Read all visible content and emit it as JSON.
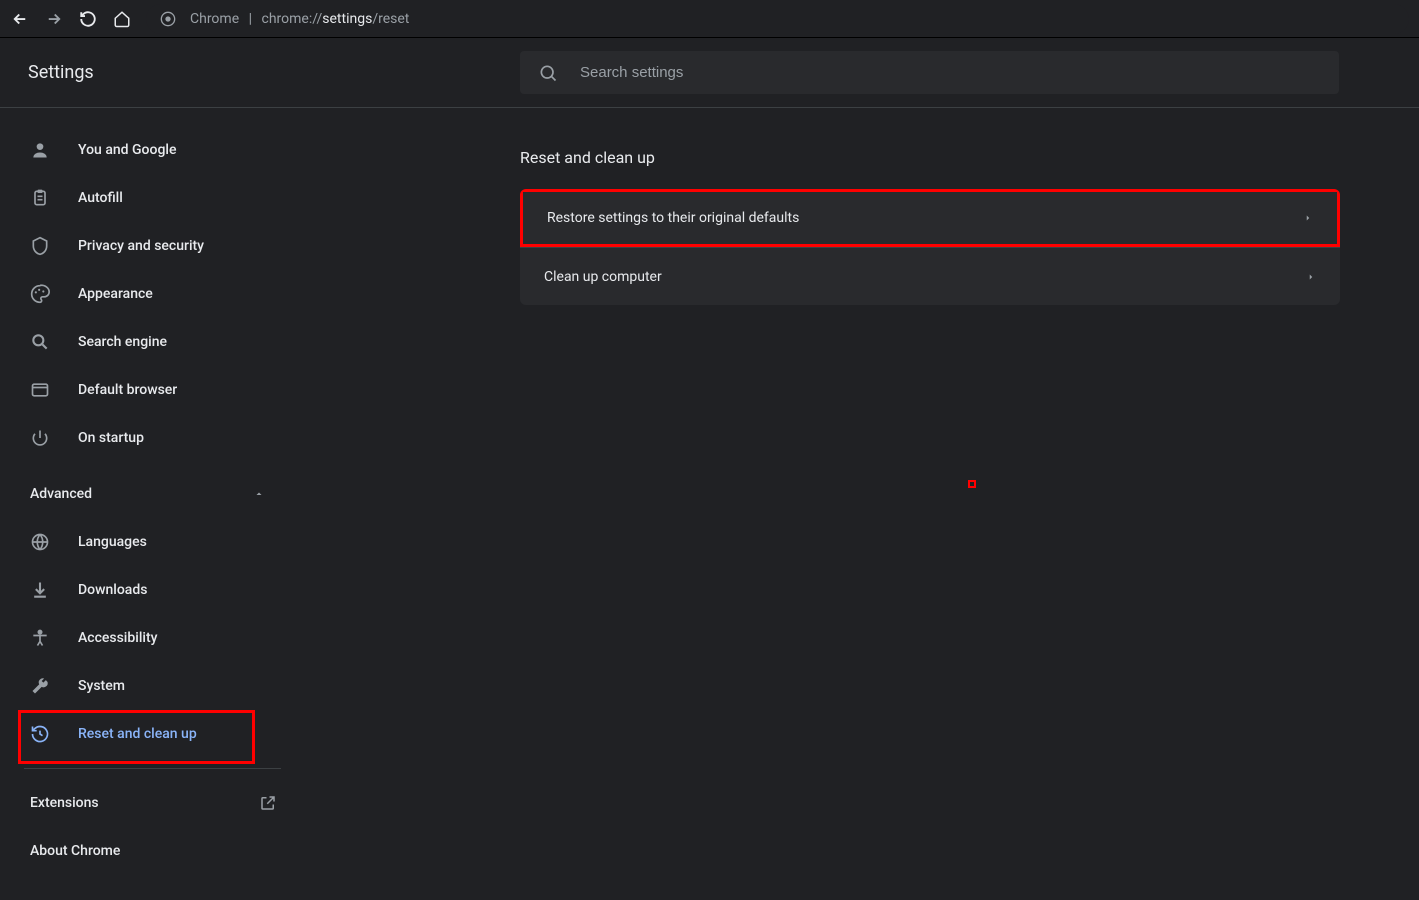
{
  "browser": {
    "url_prefix": "Chrome",
    "url_dim": "chrome://",
    "url_strong": "settings",
    "url_suffix": "/reset"
  },
  "header": {
    "title": "Settings",
    "search_placeholder": "Search settings"
  },
  "sidebar": {
    "items": [
      {
        "label": "You and Google"
      },
      {
        "label": "Autofill"
      },
      {
        "label": "Privacy and security"
      },
      {
        "label": "Appearance"
      },
      {
        "label": "Search engine"
      },
      {
        "label": "Default browser"
      },
      {
        "label": "On startup"
      }
    ],
    "advanced_label": "Advanced",
    "advanced_items": [
      {
        "label": "Languages"
      },
      {
        "label": "Downloads"
      },
      {
        "label": "Accessibility"
      },
      {
        "label": "System"
      },
      {
        "label": "Reset and clean up"
      }
    ],
    "extensions_label": "Extensions",
    "about_label": "About Chrome"
  },
  "main": {
    "section_title": "Reset and clean up",
    "rows": [
      {
        "label": "Restore settings to their original defaults"
      },
      {
        "label": "Clean up computer"
      }
    ]
  }
}
